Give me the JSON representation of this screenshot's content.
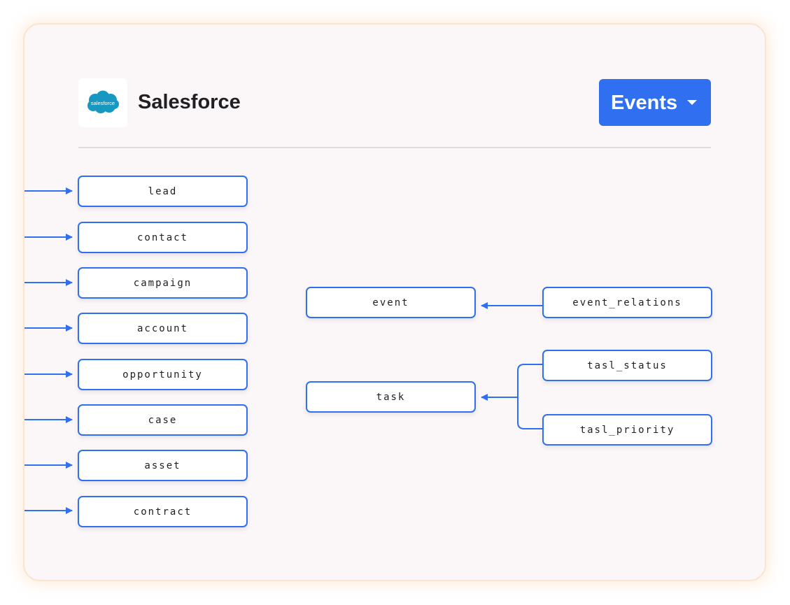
{
  "header": {
    "logo_text": "salesforce",
    "title": "Salesforce",
    "dropdown_label": "Events"
  },
  "colors": {
    "accent": "#2f6ff0",
    "logo_cloud": "#1798c1",
    "card_background": "#fbf6f7"
  },
  "icons": {
    "logo": "salesforce-cloud-icon",
    "dropdown": "chevron-down-icon",
    "connector": "arrow-right-icon"
  },
  "source_tables": [
    {
      "label": "lead"
    },
    {
      "label": "contact"
    },
    {
      "label": "campaign"
    },
    {
      "label": "account"
    },
    {
      "label": "opportunity"
    },
    {
      "label": "case"
    },
    {
      "label": "asset"
    },
    {
      "label": "contract"
    }
  ],
  "event_group": {
    "target": "event",
    "sources": [
      "event_relations"
    ]
  },
  "task_group": {
    "target": "task",
    "sources": [
      "tasl_status",
      "tasl_priority"
    ]
  }
}
